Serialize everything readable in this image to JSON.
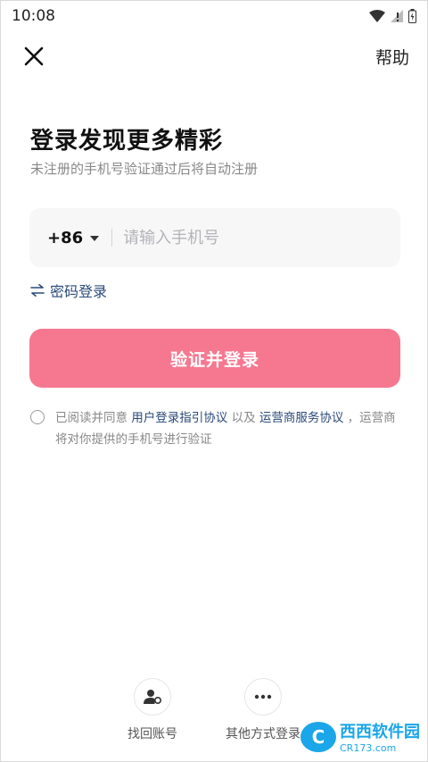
{
  "status": {
    "time": "10:08"
  },
  "topbar": {
    "help_label": "帮助"
  },
  "header": {
    "title": "登录发现更多精彩",
    "subtitle": "未注册的手机号验证通过后将自动注册"
  },
  "phone": {
    "country_code": "+86",
    "placeholder": "请输入手机号",
    "value": ""
  },
  "password_login": {
    "icon": "swap-arrows-icon",
    "label": "密码登录"
  },
  "submit": {
    "label": "验证并登录",
    "color": "#f67890"
  },
  "agreement": {
    "prefix": "已阅读并同意 ",
    "link1": "用户登录指引协议",
    "middle": " 以及 ",
    "link2": "运营商服务协议",
    "suffix": " ，运营商将对你提供的手机号进行验证",
    "link_color": "#2b4a7a"
  },
  "bottom_options": [
    {
      "icon": "user-recover-icon",
      "label": "找回账号"
    },
    {
      "icon": "more-dots-icon",
      "label": "其他方式登录"
    }
  ],
  "watermark": {
    "logo_text": "C",
    "main": "西西软件园",
    "sub": "CR173.com"
  }
}
